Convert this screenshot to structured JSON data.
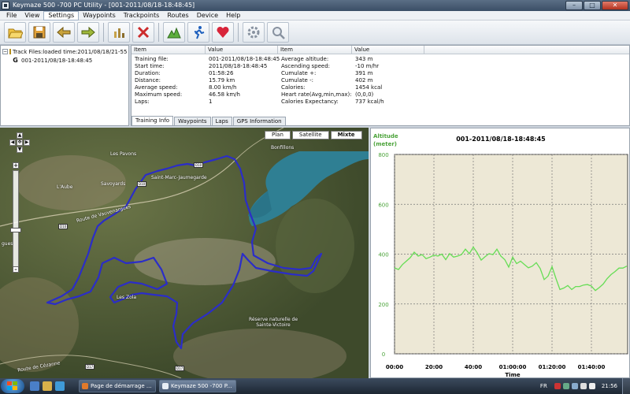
{
  "window": {
    "title": "Keymaze 500 -700 PC Utility - [001-2011/08/18-18:48:45]",
    "buttons": [
      "–",
      "□",
      "✕"
    ]
  },
  "menu": [
    "File",
    "View",
    "Settings",
    "Waypoints",
    "Trackpoints",
    "Routes",
    "Device",
    "Help"
  ],
  "toolbar": [
    "open-folder",
    "save-disk",
    "download-from-device",
    "upload-to-device",
    "chart-tools",
    "delete-tools",
    "mountain-graph",
    "runner",
    "heart",
    "settings-gear",
    "search-device"
  ],
  "tree": {
    "root": "Track Files:loaded time:2011/08/18/21-55",
    "child": "001-2011/08/18-18:48:45"
  },
  "info": {
    "headers": [
      "Item",
      "Value",
      "Item",
      "Value"
    ],
    "left": [
      [
        "Training file:",
        "001-2011/08/18-18:48:45"
      ],
      [
        "Start time:",
        "2011/08/18-18:48:45"
      ],
      [
        "Duration:",
        "01:58:26"
      ],
      [
        "Distance:",
        "15.79 km"
      ],
      [
        "Average speed:",
        "8.00 km/h"
      ],
      [
        "Maximum speed:",
        "46.58 km/h"
      ],
      [
        "Laps:",
        "1"
      ]
    ],
    "right": [
      [
        "Average altitude:",
        "343 m"
      ],
      [
        "Ascending speed:",
        "-10    m/hr"
      ],
      [
        "Cumulate +:",
        "391 m"
      ],
      [
        "Cumulate -:",
        "402 m"
      ],
      [
        "Calories:",
        "1454 kcal"
      ],
      [
        "Heart rate(Avg,min,max):",
        "(0,0,0)"
      ],
      [
        "Calories Expectancy:",
        "737  kcal/h"
      ]
    ],
    "tabs": [
      "Training Info",
      "Waypoints",
      "Laps",
      "GPS Information"
    ]
  },
  "map": {
    "types": [
      "Plan",
      "Satellite",
      "Mixte"
    ],
    "selected": "Mixte",
    "labels": [
      "Bonfillons",
      "Les Pavons",
      "Savoyards",
      "Saint-Marc-Jaumegarde",
      "L'Aube",
      "Route de Vauvenargues",
      "Les Zola",
      "Réserve naturelle de Sainte-Victoire",
      "Route de Cézanne",
      "gues"
    ],
    "roads": [
      "D10",
      "D10",
      "D10",
      "D17",
      "D17"
    ],
    "zoom": [
      "+",
      "–"
    ]
  },
  "chart_data": {
    "type": "line",
    "title": "001-2011/08/18-18:48:45",
    "ylabel": "Altitude\n(meter)",
    "xlabel": "Time",
    "ylim": [
      0,
      800
    ],
    "yticks": [
      "0",
      "200",
      "400",
      "600",
      "800"
    ],
    "xticks": [
      "00:00",
      "20:00",
      "40:00",
      "01:00:00",
      "01:20:00",
      "01:40:00"
    ],
    "xlim_minutes": [
      0,
      118.4
    ],
    "series": [
      {
        "color": "#66dd55",
        "x_minutes": [
          0,
          2,
          4,
          6,
          8,
          10,
          12,
          14,
          16,
          18,
          20,
          22,
          24,
          26,
          28,
          30,
          32,
          34,
          36,
          38,
          40,
          42,
          44,
          46,
          48,
          50,
          52,
          54,
          56,
          58,
          60,
          62,
          64,
          66,
          68,
          70,
          72,
          74,
          76,
          78,
          80,
          82,
          84,
          86,
          88,
          90,
          92,
          94,
          96,
          98,
          100,
          102,
          104,
          106,
          108,
          110,
          112,
          114,
          116,
          118
        ],
        "values": [
          345,
          338,
          358,
          372,
          386,
          408,
          392,
          398,
          382,
          388,
          396,
          392,
          400,
          378,
          402,
          388,
          392,
          398,
          420,
          402,
          428,
          405,
          376,
          390,
          402,
          398,
          420,
          392,
          378,
          348,
          388,
          362,
          372,
          358,
          345,
          352,
          366,
          342,
          298,
          312,
          350,
          302,
          258,
          264,
          274,
          258,
          270,
          270,
          276,
          278,
          272,
          254,
          266,
          280,
          302,
          318,
          330,
          344,
          344,
          352
        ]
      }
    ]
  },
  "taskbar": {
    "tasks": [
      "Page de démarrage ...",
      "Keymaze 500 -700 P..."
    ],
    "lang": "FR",
    "time": "21:56"
  }
}
